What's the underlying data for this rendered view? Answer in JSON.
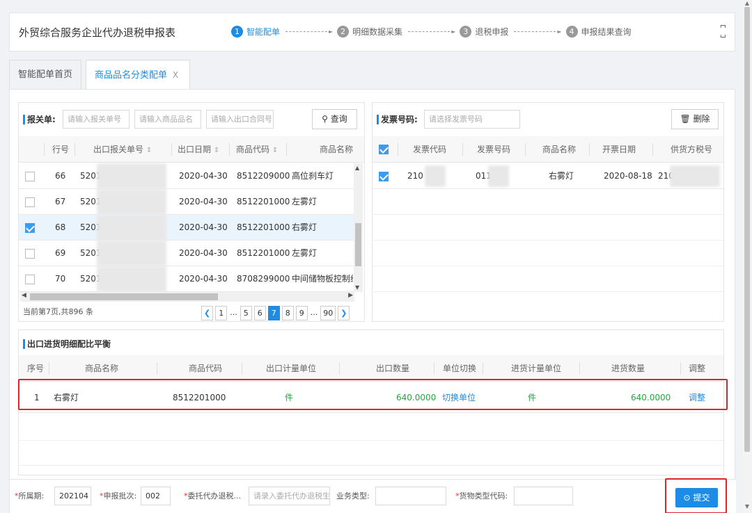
{
  "header": {
    "title": "外贸综合服务企业代办退税申报表",
    "steps": [
      {
        "num": "1",
        "label": "智能配单"
      },
      {
        "num": "2",
        "label": "明细数据采集"
      },
      {
        "num": "3",
        "label": "退税申报"
      },
      {
        "num": "4",
        "label": "申报结果查询"
      }
    ]
  },
  "tabs": [
    {
      "label": "智能配单首页"
    },
    {
      "label": "商品品名分类配单",
      "close": "X"
    }
  ],
  "left_panel": {
    "title": "报关单:",
    "placeholders": [
      "请输入报关单号",
      "请输入商品品名",
      "请输入出口合同号"
    ],
    "query_label": "查询",
    "columns": [
      "行号",
      "出口报关单号",
      "出口日期",
      "商品代码",
      "商品名称"
    ],
    "sort_glyph": "⇕",
    "rows": [
      {
        "no": "66",
        "decl": "5201",
        "date": "2020-04-30",
        "code": "8512209000",
        "name": "高位刹车灯",
        "checked": false
      },
      {
        "no": "67",
        "decl": "5201",
        "date": "2020-04-30",
        "code": "8512201000",
        "name": "左雾灯",
        "checked": false
      },
      {
        "no": "68",
        "decl": "5201",
        "date": "2020-04-30",
        "code": "8512201000",
        "name": "右雾灯",
        "checked": true
      },
      {
        "no": "69",
        "decl": "5201",
        "date": "2020-04-30",
        "code": "8512201000",
        "name": "左雾灯",
        "checked": false
      },
      {
        "no": "70",
        "decl": "5201",
        "date": "2020-04-30",
        "code": "8708299000",
        "name": "中间储物板控制组件",
        "checked": false
      }
    ],
    "page_info": "当前第7页,共896 条",
    "pages": [
      "1",
      "...",
      "5",
      "6",
      "7",
      "8",
      "9",
      "...",
      "90"
    ],
    "current_page": "7"
  },
  "right_panel": {
    "title": "发票号码:",
    "placeholder": "请选择发票号码",
    "delete_label": "删除",
    "columns": [
      "发票代码",
      "发票号码",
      "商品名称",
      "开票日期",
      "供货方税号"
    ],
    "rows": [
      {
        "code": "210",
        "number": "011",
        "name": "右雾灯",
        "date": "2020-08-18",
        "tax": "210",
        "checked": true
      }
    ]
  },
  "bottom_panel": {
    "title": "出口进货明细配比平衡",
    "columns": [
      "序号",
      "商品名称",
      "商品代码",
      "出口计量单位",
      "出口数量",
      "单位切换",
      "进货计量单位",
      "进货数量",
      "调整"
    ],
    "rows": [
      {
        "seq": "1",
        "name": "右雾灯",
        "code": "8512201000",
        "export_unit": "件",
        "export_qty": "640.0000",
        "switch": "切换单位",
        "import_unit": "件",
        "import_qty": "640.0000",
        "adjust": "调整"
      }
    ]
  },
  "footer": {
    "period_label": "所属期:",
    "period_value": "202104",
    "batch_label": "申报批次:",
    "batch_value": "002",
    "agent_label": "委托代办退税...",
    "agent_placeholder": "请录入委托代办退税生",
    "biz_label": "业务类型:",
    "goods_label": "货物类型代码:",
    "submit_label": "提交",
    "required_mark": "*"
  },
  "colors": {
    "accent": "#1e8ce4",
    "highlight": "#d9262c",
    "green": "#22a83a"
  }
}
